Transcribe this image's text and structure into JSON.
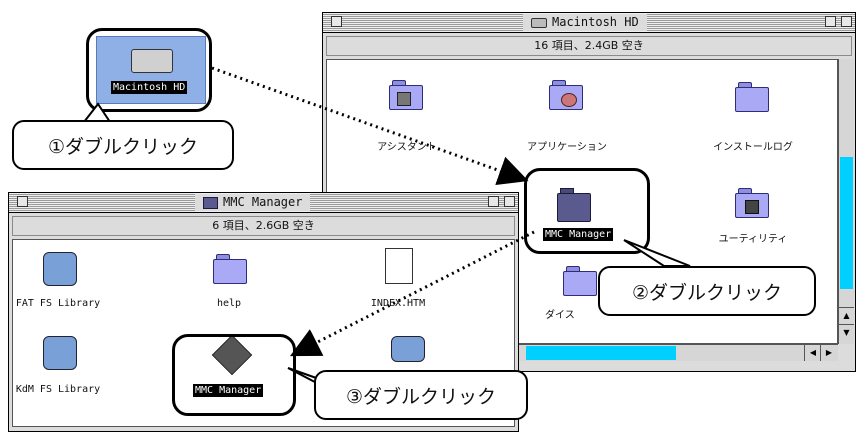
{
  "desktop": {
    "hd_icon_label": "Macintosh HD"
  },
  "window_hd": {
    "title": "Macintosh HD",
    "info": "16 項目、2.4GB 空き",
    "items": [
      {
        "label": "アシスタント"
      },
      {
        "label": "アプリケーション"
      },
      {
        "label": "インストールログ"
      },
      {
        "label": "MMC Manager"
      },
      {
        "label": "ユーティリティ"
      },
      {
        "label": "ダイス"
      }
    ]
  },
  "window_mmc": {
    "title": "MMC Manager",
    "info": "6 項目、2.6GB 空き",
    "items": [
      {
        "label": "FAT FS Library"
      },
      {
        "label": "help"
      },
      {
        "label": "INDEX.HTM"
      },
      {
        "label": "KdM FS Library"
      },
      {
        "label": "MMC Manager"
      },
      {
        "label": ""
      }
    ]
  },
  "callouts": {
    "step1": "①ダブルクリック",
    "step2": "②ダブルクリック",
    "step3": "③ダブルクリック"
  },
  "colors": {
    "folder": "#a9a9f5",
    "scroll_accent": "#00d0ff",
    "selection": "#000000"
  }
}
